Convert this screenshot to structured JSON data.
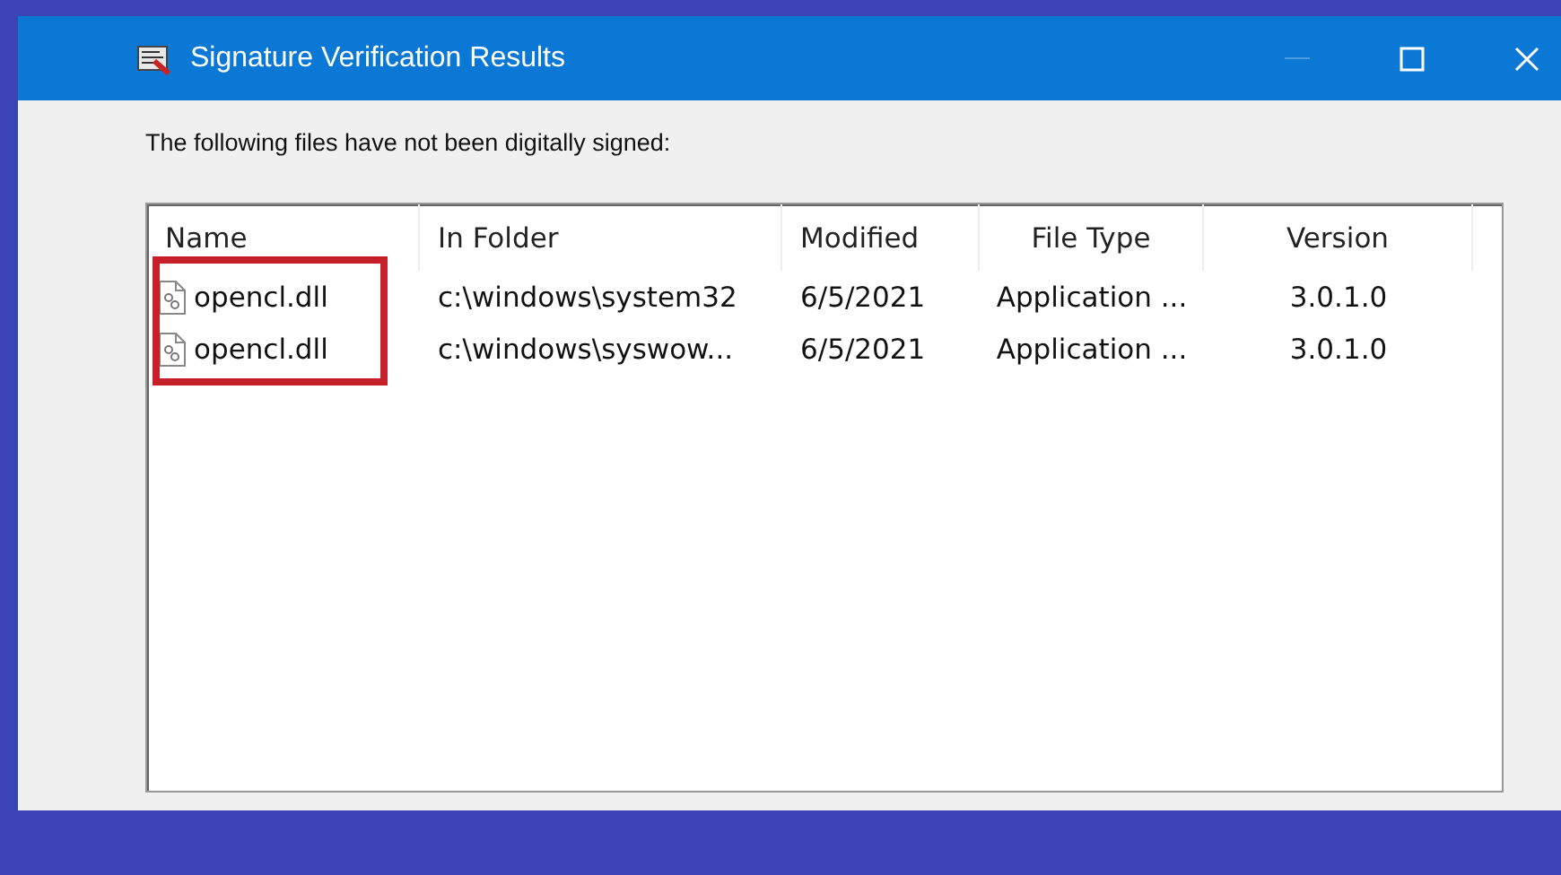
{
  "window": {
    "title": "Signature Verification Results"
  },
  "message": "The following files have not been digitally signed:",
  "table": {
    "columns": [
      "Name",
      "In Folder",
      "Modified",
      "File Type",
      "Version"
    ],
    "rows": [
      {
        "cells": [
          "opencl.dll",
          "c:\\windows\\system32",
          "6/5/2021",
          "Application ...",
          "3.0.1.0"
        ]
      },
      {
        "cells": [
          "opencl.dll",
          "c:\\windows\\syswow...",
          "6/5/2021",
          "Application ...",
          "3.0.1.0"
        ]
      }
    ]
  },
  "annotation": {
    "kind": "frame",
    "color": "#c8202b"
  }
}
